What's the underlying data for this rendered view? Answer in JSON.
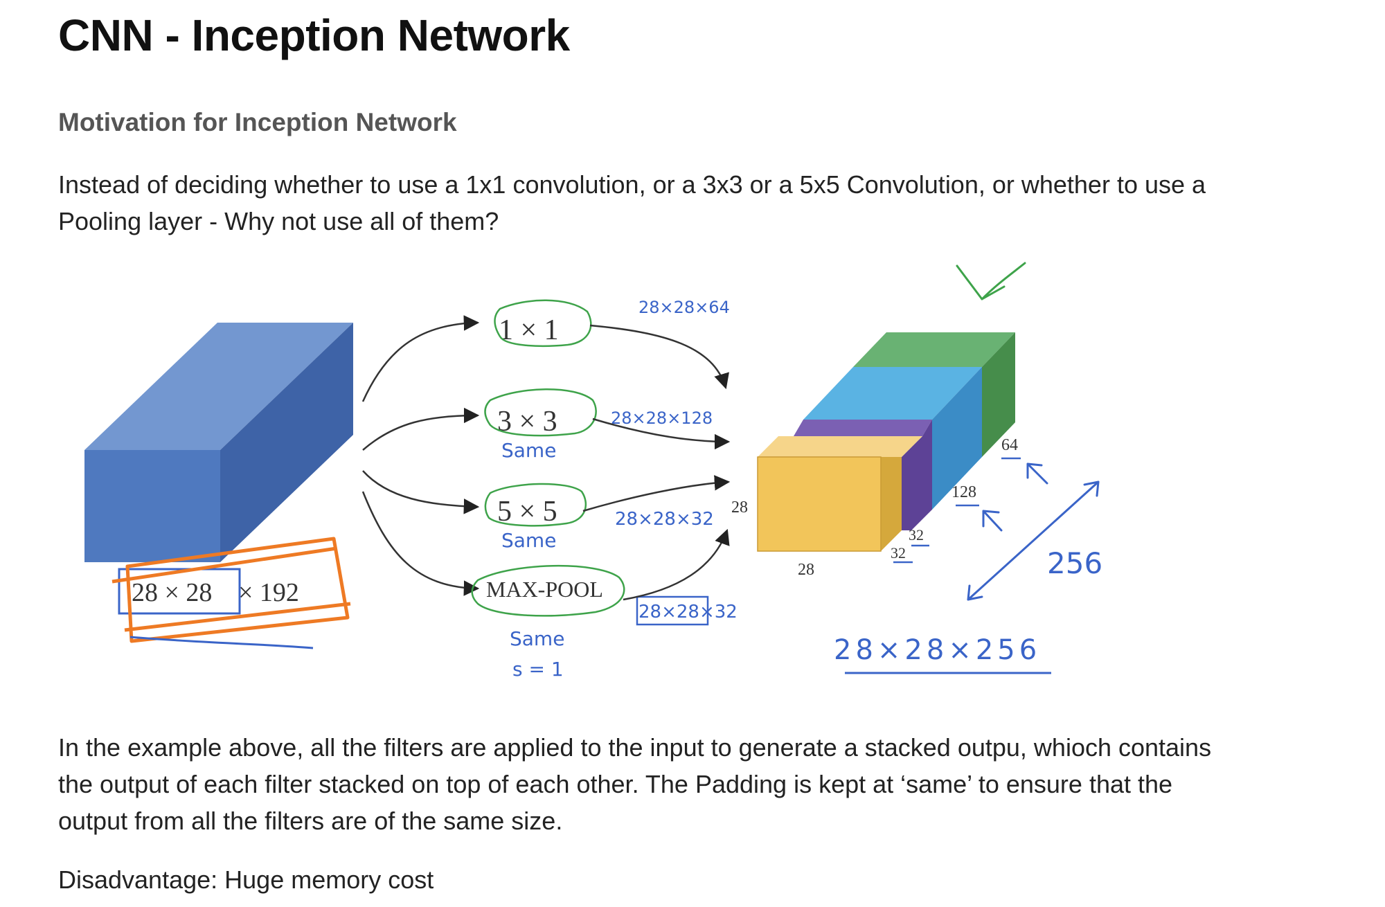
{
  "header": {
    "title": "CNN - Inception Network",
    "subtitle": "Motivation for Inception Network"
  },
  "intro": {
    "text": "Instead of deciding whether to use a 1x1 convolution, or a 3x3 or a 5x5 Convolution, or whether to use a Pooling layer - Why not use all of them?"
  },
  "diagram": {
    "input_dims_a": "28 × 28",
    "input_dims_b": "× 192",
    "filters": [
      {
        "label": "1 × 1",
        "note": "",
        "out": "28×28×64"
      },
      {
        "label": "3 × 3",
        "note": "Same",
        "out": "28×28×128"
      },
      {
        "label": "5 × 5",
        "note": "Same",
        "out": "28×28×32"
      },
      {
        "label": "MAX-POOL",
        "note": "Same",
        "note2": "s = 1",
        "out": "28×28×32"
      }
    ],
    "block_labels": {
      "height": "28",
      "width": "28",
      "d32a": "32",
      "d32b": "32",
      "d128": "128",
      "d64": "64"
    },
    "depth_total": "256",
    "output_dims": "28×28×256",
    "colors": {
      "input_front": "#4f79bf",
      "input_top": "#7397d0",
      "input_side": "#3e63a7",
      "yellow": "#f2c55a",
      "purple": "#6a4ea0",
      "blue": "#5ab3e3",
      "green": "#69b273",
      "annotation_blue": "#3a64c8",
      "annotation_green": "#3ea34a",
      "annotation_orange": "#ee7a24"
    }
  },
  "body": {
    "explanation": "In the example above, all the filters are applied to the input to generate a stacked outpu, whioch contains the output of each filter stacked on top of each other. The Padding is kept at ‘same’ to ensure that the output from all the filters are of the same size.",
    "disadvantage": "Disadvantage: Huge memory cost"
  }
}
